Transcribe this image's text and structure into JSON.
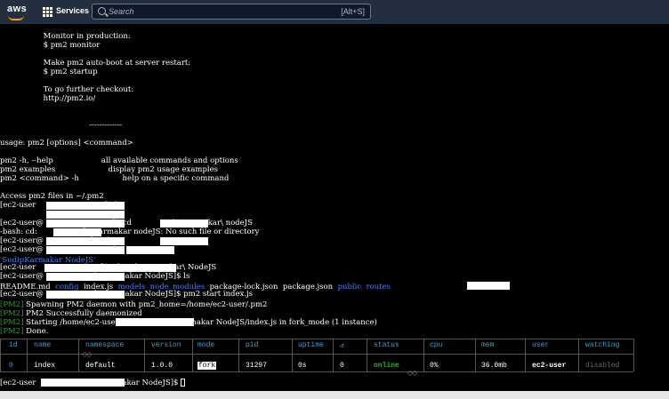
{
  "header": {
    "logo_text": "aws",
    "services_label": "Services",
    "search_placeholder": "Search",
    "search_shortcut": "[Alt+S]"
  },
  "terminal": {
    "lines": [
      "                  Monitor in production:",
      "                  $ pm2 monitor",
      "",
      "                  Make pm2 auto-boot at server restart:",
      "                  $ pm2 startup",
      "",
      "                  To go further checkout:",
      "                  http://pm2.io/",
      "",
      "",
      "                                     -------------",
      "",
      "usage: pm2 [options] <command>",
      "",
      "pm2 -h, --help                    all available commands and options",
      "pm2 examples                      display pm2 usage examples",
      "pm2 <command> -h                  help on a specific command",
      "",
      "Access pm2 files in ~/.pm2",
      "[ec2-user                          ~]$ ls",
      "",
      "[ec2-user@                          ~]$ cd            SudipKarmakar\\ nodeJS",
      "-bash: cd:              SudipKarmakar nodeJS: No such file or directory",
      "[ec2-user@                 ~]$ cd",
      "[ec2-user@                          $ ls",
      "",
      "[ec2-user                           ]$ cd SudipKarmakar\\ NodeJS",
      "[ec2-user@                SudipKarmakar NodeJS]$ ls",
      "",
      "[ec2-user@                SudipKarmakar NodeJS]$ pm2 start index.js",
      "",
      "",
      "",
      ""
    ],
    "ls_blue_line": "'SudipKarmakar NodeJS'",
    "readme_line": {
      "readme": "README.md",
      "config": "config",
      "index": "index.js",
      "models": "models",
      "node_modules": "node_modules",
      "lock": "package-lock.json",
      "pkg": "package.json",
      "public": "public",
      "routes": "routes"
    },
    "pm2_tag": "[PM2]",
    "pm2_lines": [
      "Spawning PM2 daemon with pm2_home=/home/ec2-user/.pm2",
      "PM2 Successfully daemonized",
      "Starting /home/ec2-use                    dipKarmakar NodeJS/index.js in fork_mode (1 instance)",
      "Done."
    ],
    "prompt_last": "[ec2-user                  SudipKarmakar NodeJS]$ "
  },
  "pm2_table": {
    "headers": [
      "id",
      "name",
      "namespace",
      "version",
      "mode",
      "pid",
      "uptime",
      "↺",
      "status",
      "cpu",
      "mem",
      "user",
      "watching"
    ],
    "row": [
      "0",
      "index",
      "default",
      "1.0.0",
      "fork",
      "31297",
      "0s",
      "0",
      "online",
      "0%",
      "36.0mb",
      "ec2-user",
      "disabled"
    ]
  },
  "colors": {
    "topbar": "#232f3e",
    "brand_orange": "#ff9900",
    "pm2_green": "#3a9a3a",
    "dir_blue": "#4c7cff",
    "table_header": "#3aa0d8",
    "status_online": "#3aa83a"
  }
}
